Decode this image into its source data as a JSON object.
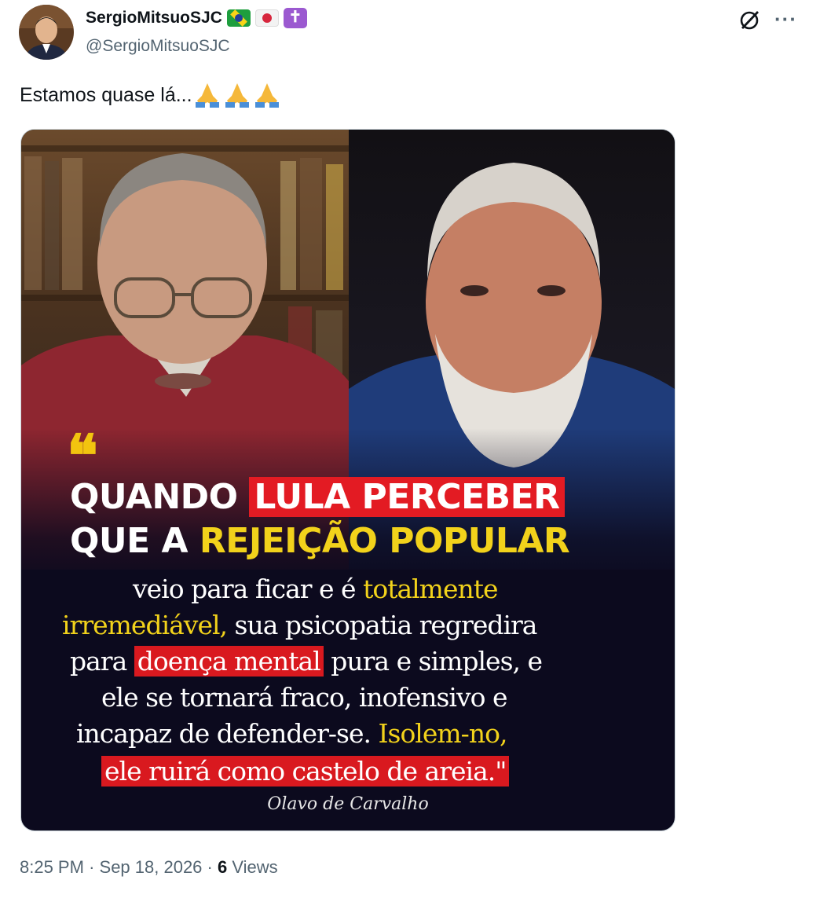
{
  "author": {
    "display_name": "SergioMitsuoSJC",
    "handle": "@SergioMitsuoSJC",
    "badges": [
      "brazil-flag",
      "japan-flag",
      "latin-cross"
    ],
    "cross_glyph": "✝"
  },
  "tweet": {
    "text": "Estamos quase lá...",
    "emoji": "folded-hands"
  },
  "media": {
    "quote_mark": "❝",
    "line1_plain": "QUANDO",
    "line1_highlight": "LULA PERCEBER",
    "line2_plain": "QUE A",
    "line2_yellow": "REJEIÇÃO POPULAR",
    "body": {
      "l1_a": "veio para ficar e é",
      "l1_b": "totalmente",
      "l2_a": "irremediável,",
      "l2_b": "sua psicopatia regredira",
      "l3_a": "para",
      "l3_b": "doença mental",
      "l3_c": "pura e simples, e",
      "l4": "ele se tornará fraco, inofensivo e",
      "l5_a": "incapaz de defender-se.",
      "l5_b": "Isolem-no,",
      "l6": "ele ruirá como castelo de areia.\""
    },
    "attribution": "Olavo de Carvalho"
  },
  "footer": {
    "time": "8:25 PM",
    "separator": "·",
    "date": "Sep 18, 2026",
    "views_count": "6",
    "views_label": "Views"
  },
  "colors": {
    "highlight_red": "#e31b23",
    "highlight_yellow": "#f2d21b",
    "muted_text": "#536471"
  }
}
